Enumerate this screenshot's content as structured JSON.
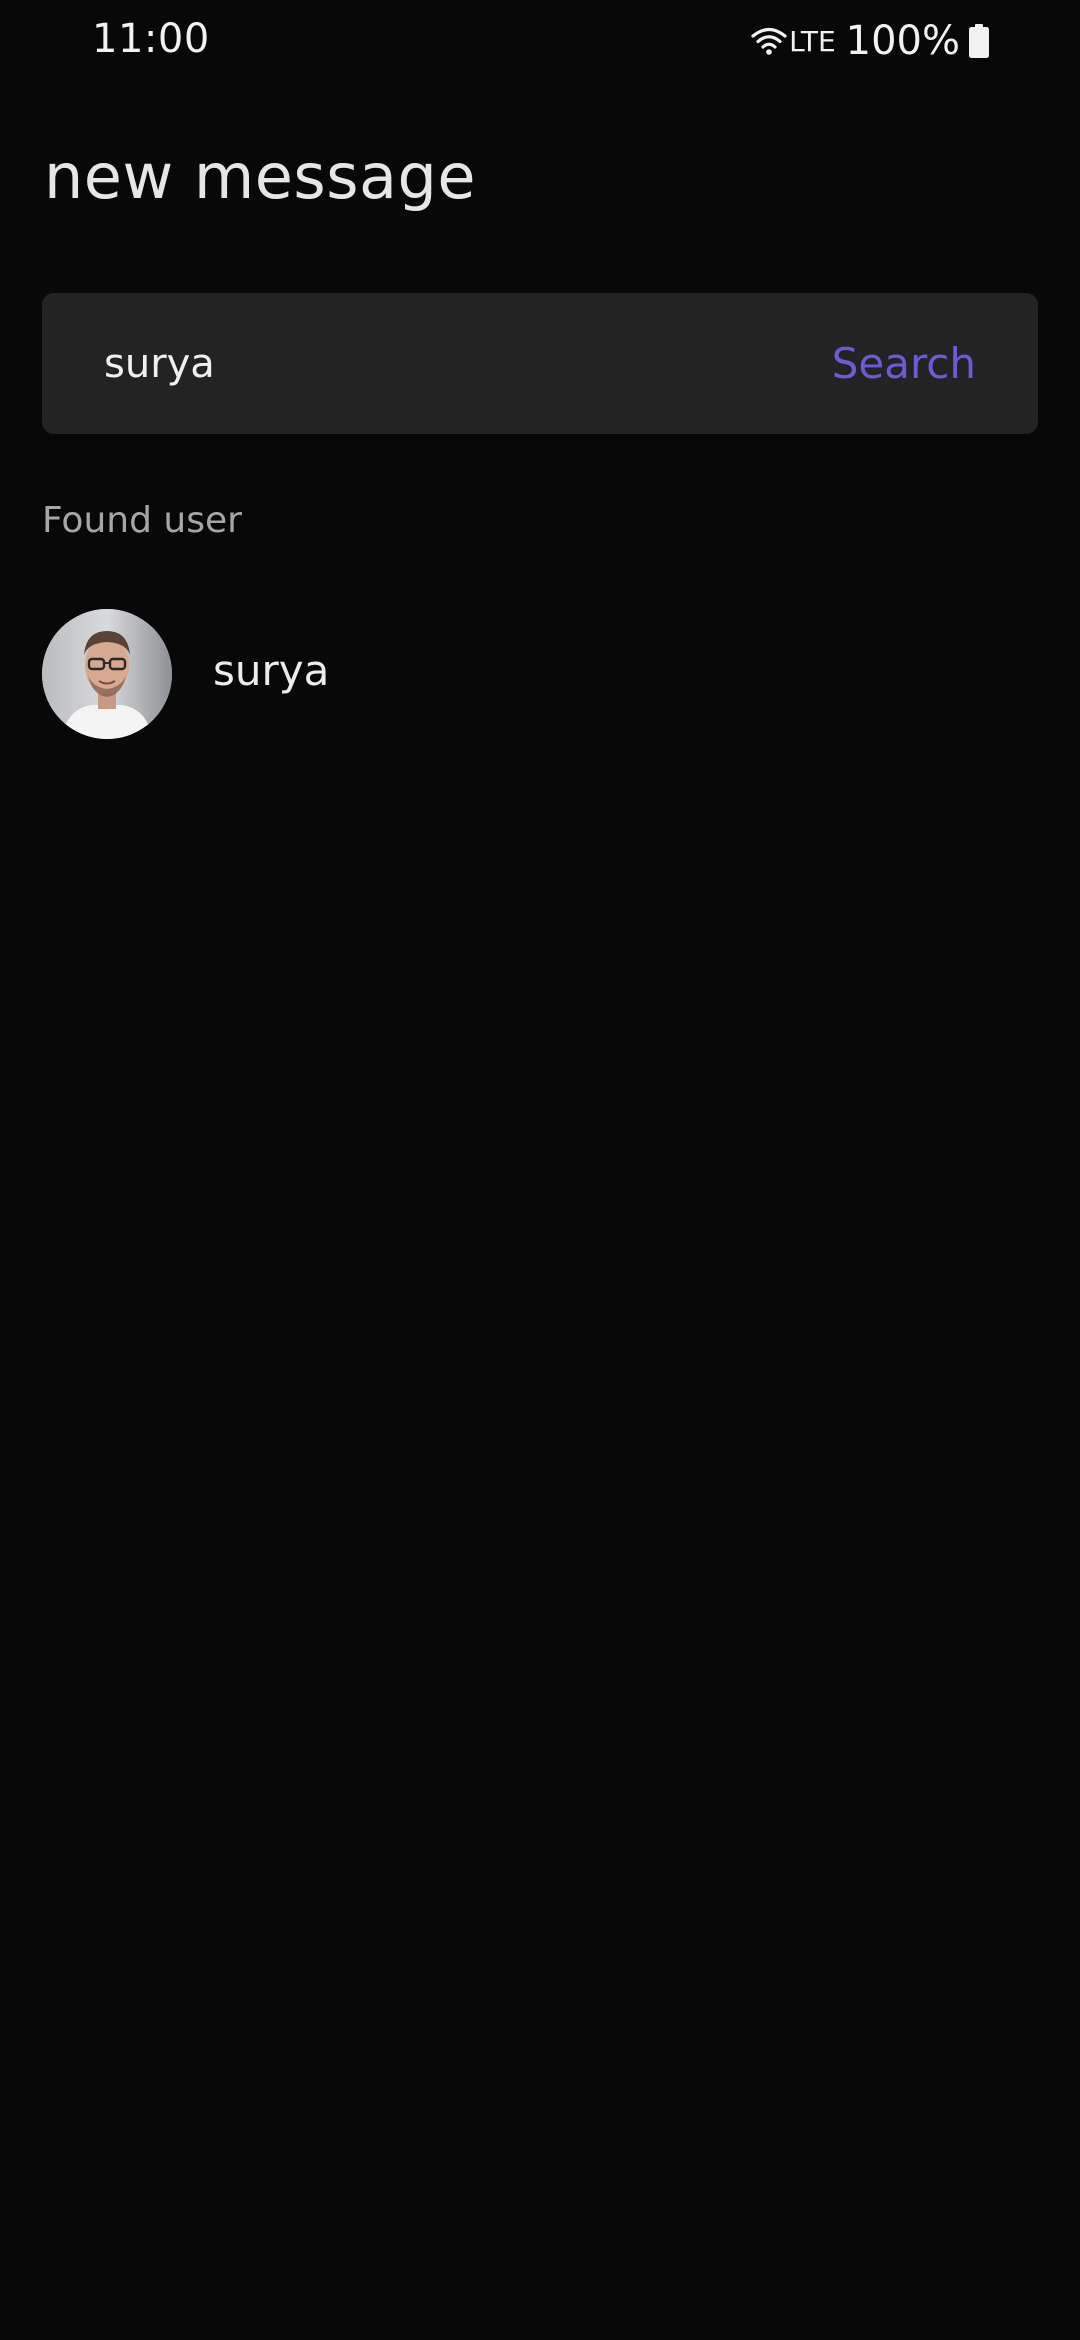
{
  "status_bar": {
    "time": "11:00",
    "network": "LTE",
    "battery": "100%"
  },
  "header": {
    "title": "new message"
  },
  "search": {
    "value": "surya",
    "button_label": "Search"
  },
  "results": {
    "section_label": "Found user",
    "users": [
      {
        "name": "surya",
        "avatar_icon": "user-avatar-photo"
      }
    ]
  },
  "colors": {
    "background": "#080808",
    "search_bar": "#232323",
    "accent": "#6a5bd6"
  }
}
